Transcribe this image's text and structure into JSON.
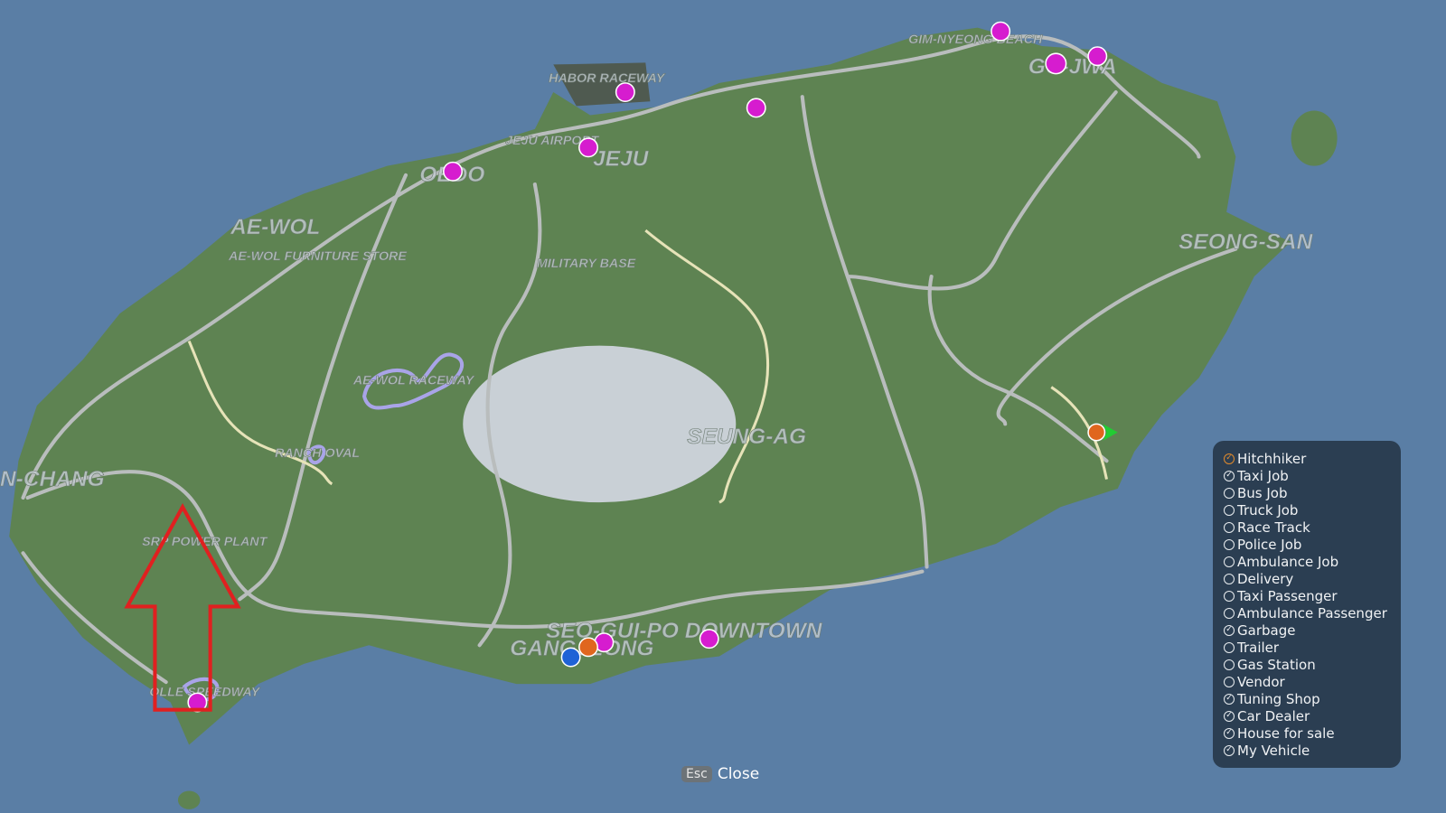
{
  "map": {
    "colors": {
      "sea": "#5a7ea5",
      "land": "#5e8352",
      "road": "#b9bdbd",
      "dirt_road": "#e6e3b8",
      "crater": "#c9d0d6",
      "marker": "#d61ccf",
      "house": "#e0661e",
      "police": "#1f62d6",
      "arrow": "#e02020",
      "player": "#22cc33"
    },
    "labels": {
      "gim_nyeong": "GIM-NYEONG BEACH",
      "gu_jwa": "GU-JWA",
      "habor": "HABOR RACEWAY",
      "airport": "JEJU AIRPORT",
      "jeju": "JEJU",
      "oedo": "OEDO",
      "aewol": "AE-WOL",
      "furniture": "AE-WOL FURNITURE STORE",
      "military": "MILITARY BASE",
      "seongsan": "SEONG-SAN",
      "aewol_raceway": "AE-WOL RACEWAY",
      "ranch": "RANCH OVAL",
      "seungag": "SEUNG-AG",
      "hanchang": "N-CHANG",
      "power": "SRP POWER PLANT",
      "seoguipo": "SEO-GUI-PO DOWNTOWN",
      "gangjeong": "GANGJEONG",
      "olle": "OLLE SPEEDWAY"
    },
    "markers": [
      {
        "icon": "house-for-sale-icon"
      },
      {
        "icon": "house-for-sale-icon"
      },
      {
        "icon": "house-for-sale-icon"
      },
      {
        "icon": "tuning-shop-icon"
      },
      {
        "icon": "tuning-shop-icon"
      },
      {
        "icon": "tuning-shop-icon"
      },
      {
        "icon": "car-dealer-icon"
      },
      {
        "icon": "car-dealer-icon"
      },
      {
        "icon": "home-icon"
      },
      {
        "icon": "police-car-icon"
      },
      {
        "icon": "hitchhiker-icon"
      },
      {
        "icon": "player-arrow-icon"
      }
    ]
  },
  "legend": {
    "items": [
      {
        "label": "Hitchhiker",
        "checked": true,
        "accent": "orange"
      },
      {
        "label": "Taxi Job",
        "checked": true
      },
      {
        "label": "Bus Job",
        "checked": false
      },
      {
        "label": "Truck Job",
        "checked": false
      },
      {
        "label": "Race Track",
        "checked": false
      },
      {
        "label": "Police Job",
        "checked": false
      },
      {
        "label": "Ambulance Job",
        "checked": false
      },
      {
        "label": "Delivery",
        "checked": false
      },
      {
        "label": "Taxi Passenger",
        "checked": false
      },
      {
        "label": "Ambulance Passenger",
        "checked": false
      },
      {
        "label": "Garbage",
        "checked": true
      },
      {
        "label": "Trailer",
        "checked": false
      },
      {
        "label": "Gas Station",
        "checked": false
      },
      {
        "label": "Vendor",
        "checked": false
      },
      {
        "label": "Tuning Shop",
        "checked": true
      },
      {
        "label": "Car Dealer",
        "checked": true
      },
      {
        "label": "House for sale",
        "checked": true
      },
      {
        "label": "My Vehicle",
        "checked": true
      }
    ]
  },
  "footer": {
    "key": "Esc",
    "label": "Close"
  }
}
